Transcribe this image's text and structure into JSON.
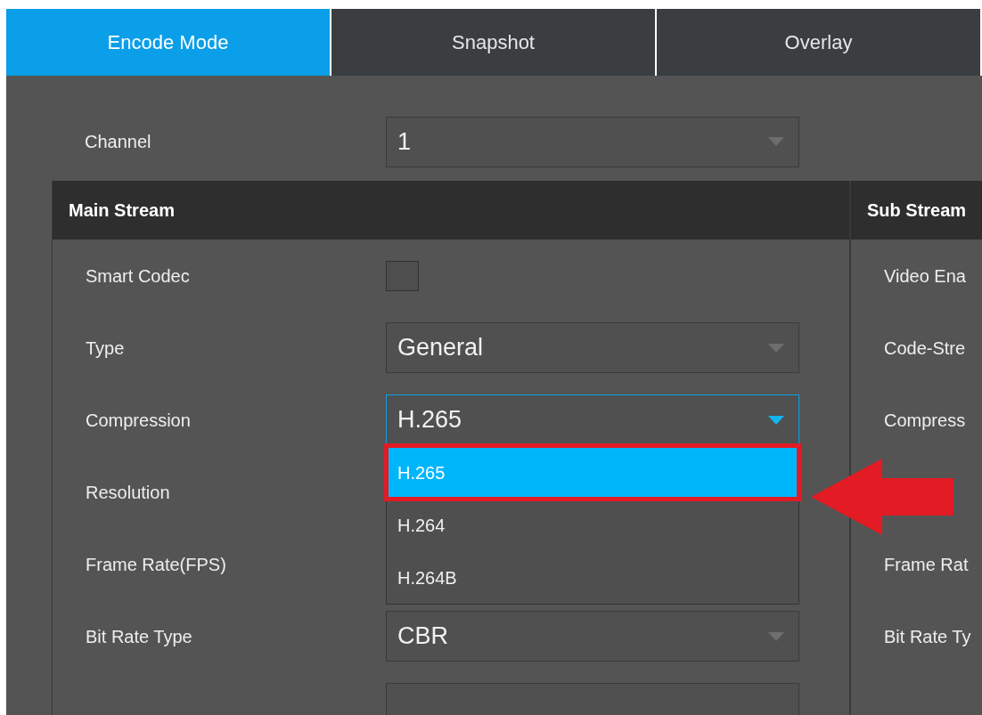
{
  "tabs": [
    {
      "label": "Encode Mode",
      "selected": true
    },
    {
      "label": "Snapshot",
      "selected": false
    },
    {
      "label": "Overlay",
      "selected": false
    }
  ],
  "channel": {
    "label": "Channel",
    "value": "1"
  },
  "main_stream": {
    "title": "Main Stream",
    "fields": [
      {
        "kind": "checkbox",
        "label": "Smart Codec",
        "checked": false
      },
      {
        "kind": "select",
        "label": "Type",
        "value": "General",
        "focused": false
      },
      {
        "kind": "select",
        "label": "Compression",
        "value": "H.265",
        "focused": true,
        "options": [
          {
            "label": "H.265",
            "selected": true,
            "annotated": true
          },
          {
            "label": "H.264",
            "selected": false,
            "annotated": false
          },
          {
            "label": "H.264B",
            "selected": false,
            "annotated": false
          }
        ]
      },
      {
        "kind": "label",
        "label": "Resolution"
      },
      {
        "kind": "label",
        "label": "Frame Rate(FPS)"
      },
      {
        "kind": "select",
        "label": "Bit Rate Type",
        "value": "CBR",
        "focused": false
      },
      {
        "kind": "cut_off"
      }
    ]
  },
  "sub_stream": {
    "title": "Sub Stream",
    "rows": [
      {
        "kind": "label",
        "label": "Video Ena"
      },
      {
        "kind": "label",
        "label": "Code-Stre"
      },
      {
        "kind": "label",
        "label": "Compress"
      },
      {
        "kind": "covered"
      },
      {
        "kind": "label",
        "label": "Frame Rat"
      },
      {
        "kind": "label",
        "label": "Bit Rate Ty"
      }
    ]
  }
}
